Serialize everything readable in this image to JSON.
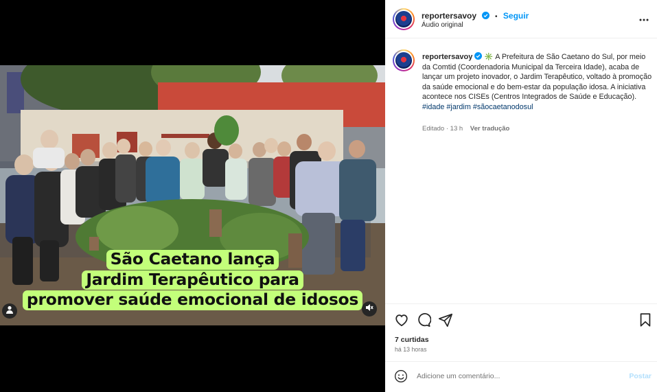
{
  "media": {
    "caption_lines": [
      "São Caetano lança",
      "Jardim Terapêutico para",
      "promover saúde emocional de idosos"
    ],
    "icons": {
      "user": "user-icon",
      "mute": "muted-speaker-icon"
    },
    "accent": "#c3ff7a"
  },
  "header": {
    "username": "reportersavoy",
    "separator": "•",
    "follow_label": "Seguir",
    "audio_label": "Áudio original",
    "more_icon": "more-dots-icon"
  },
  "post": {
    "username": "reportersavoy",
    "emoji": "✳️",
    "body": "A Prefeitura de São Caetano do Sul, por meio da Comtid (Coordenadoria Municipal da Terceira Idade), acaba de lançar um projeto inovador, o Jardim Terapêutico, voltado à promoção da saúde emocional e do bem-estar da população idosa. A iniciativa acontece nos CISEs (Centros Integrados de Saúde e Educação).",
    "hashtags": "#idade #jardim #sãocaetanodosul",
    "edited": "Editado · 13 h",
    "translate_label": "Ver tradução"
  },
  "actions": {
    "icons": [
      "heart-icon",
      "comment-icon",
      "share-icon",
      "bookmark-icon"
    ]
  },
  "stats": {
    "likes": "7 curtidas",
    "time": "há 13 horas"
  },
  "comment": {
    "placeholder": "Adicione um comentário...",
    "post_label": "Postar"
  },
  "colors": {
    "link": "#0095f6",
    "hashtag": "#00376b",
    "muted": "#737373"
  }
}
